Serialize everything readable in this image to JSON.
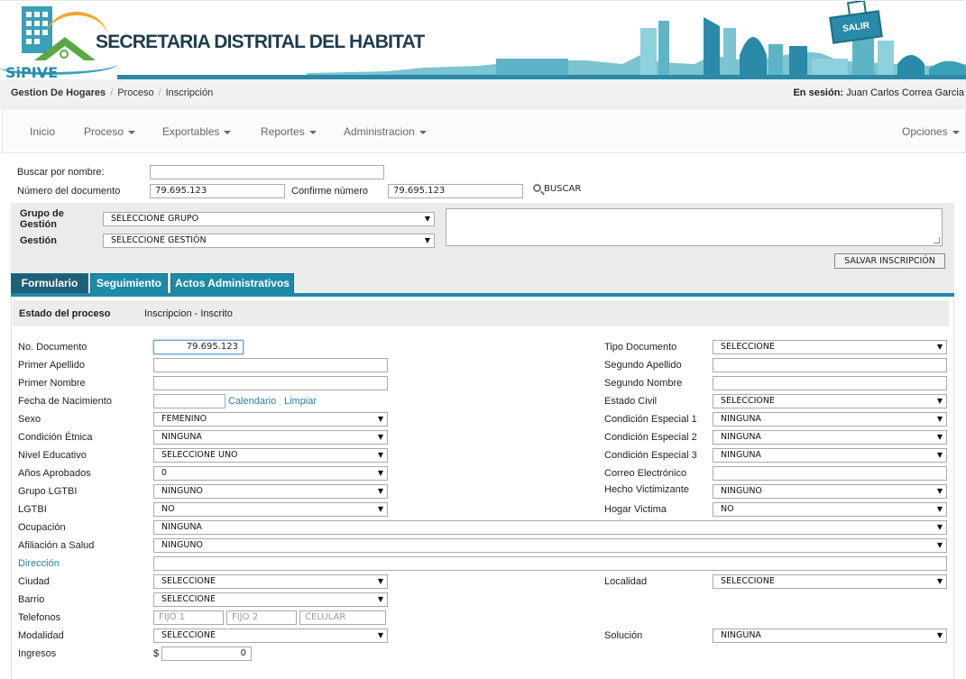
{
  "header": {
    "logo_text": "SiPIVE",
    "title": "SECRETARIA DISTRITAL DEL HABITAT",
    "logout_label": "SALIR"
  },
  "breadcrumb": {
    "items": [
      "Gestion De Hogares",
      "Proceso",
      "Inscripción"
    ],
    "session_label": "En sesión:",
    "session_user": "Juan Carlos Correa Garcia"
  },
  "nav": {
    "items": [
      {
        "label": "Inicio",
        "dropdown": false
      },
      {
        "label": "Proceso",
        "dropdown": true
      },
      {
        "label": "Exportables",
        "dropdown": true
      },
      {
        "label": "Reportes",
        "dropdown": true
      },
      {
        "label": "Administracion",
        "dropdown": true
      }
    ],
    "options_label": "Opciones"
  },
  "search": {
    "name_label": "Buscar por nombre:",
    "name_value": "",
    "doc_label": "Número del documento",
    "doc_value": "79.695.123",
    "confirm_label": "Confirme número",
    "confirm_value": "79.695.123",
    "search_button": "BUSCAR"
  },
  "gestion": {
    "group_label": "Grupo de Gestión",
    "group_value": "SELECCIONE GRUPO",
    "gestion_label": "Gestión",
    "gestion_value": "SELECCIONE GESTIÓN",
    "save_button": "SALVAR INSCRIPCIÓN"
  },
  "tabs": [
    {
      "label": "Formulario",
      "active": true
    },
    {
      "label": "Seguimiento",
      "active": false
    },
    {
      "label": "Actos Administrativos",
      "active": false
    }
  ],
  "form": {
    "estado_label": "Estado del proceso",
    "estado_value": "Inscripcion - Inscrito",
    "no_documento_label": "No. Documento",
    "no_documento_value": "79.695.123",
    "primer_apellido_label": "Primer Apellido",
    "primer_nombre_label": "Primer Nombre",
    "fecha_nacimiento_label": "Fecha de Nacimiento",
    "calendario_link": "Calendario",
    "limpiar_link": "Limpiar",
    "sexo_label": "Sexo",
    "sexo_value": "FEMENINO",
    "condicion_etnica_label": "Condición Étnica",
    "condicion_etnica_value": "NINGUNA",
    "nivel_educativo_label": "Nivel Educativo",
    "nivel_educativo_value": "SELECCIONE UNO",
    "anos_aprobados_label": "Años Aprobados",
    "anos_aprobados_value": "0",
    "grupo_lgtbi_label": "Grupo LGTBI",
    "grupo_lgtbi_value": "NINGUNO",
    "lgtbi_label": "LGTBI",
    "lgtbi_value": "NO",
    "ocupacion_label": "Ocupación",
    "ocupacion_value": "NINGUNA",
    "afiliacion_label": "Afiliación a Salud",
    "afiliacion_value": "NINGUNO",
    "direccion_label": "Dirección",
    "ciudad_label": "Ciudad",
    "ciudad_value": "SELECCIONE",
    "barrio_label": "Barrio",
    "barrio_value": "SELECCIONE",
    "telefonos_label": "Telefonos",
    "fijo1_placeholder": "FIJO 1",
    "fijo2_placeholder": "FIJO 2",
    "celular_placeholder": "CELULAR",
    "modalidad_label": "Modalidad",
    "modalidad_value": "SELECCIONE",
    "ingresos_label": "Ingresos",
    "ingresos_currency": "$",
    "ingresos_value": "0",
    "tipo_documento_label": "Tipo Documento",
    "tipo_documento_value": "SELECCIONE",
    "segundo_apellido_label": "Segundo Apellido",
    "segundo_nombre_label": "Segundo Nombre",
    "estado_civil_label": "Estado Civil",
    "estado_civil_value": "SELECCIONE",
    "cond_especial1_label": "Condición Especial 1",
    "cond_especial1_value": "NINGUNA",
    "cond_especial2_label": "Condición Especial 2",
    "cond_especial2_value": "NINGUNA",
    "cond_especial3_label": "Condición Especial 3",
    "cond_especial3_value": "NINGUNA",
    "correo_label": "Correo Electrónico",
    "hecho_victimizante_label": "Hecho Victimizante",
    "hecho_victimizante_value": "NINGUNO",
    "hogar_victima_label": "Hogar Victima",
    "hogar_victima_value": "NO",
    "localidad_label": "Localidad",
    "localidad_value": "SELECCIONE",
    "solucion_label": "Solución",
    "solucion_value": "NINGUNA"
  },
  "colors": {
    "accent": "#1d8aa8",
    "accent_dark": "#1f5f78",
    "link": "#2a7fa8"
  }
}
